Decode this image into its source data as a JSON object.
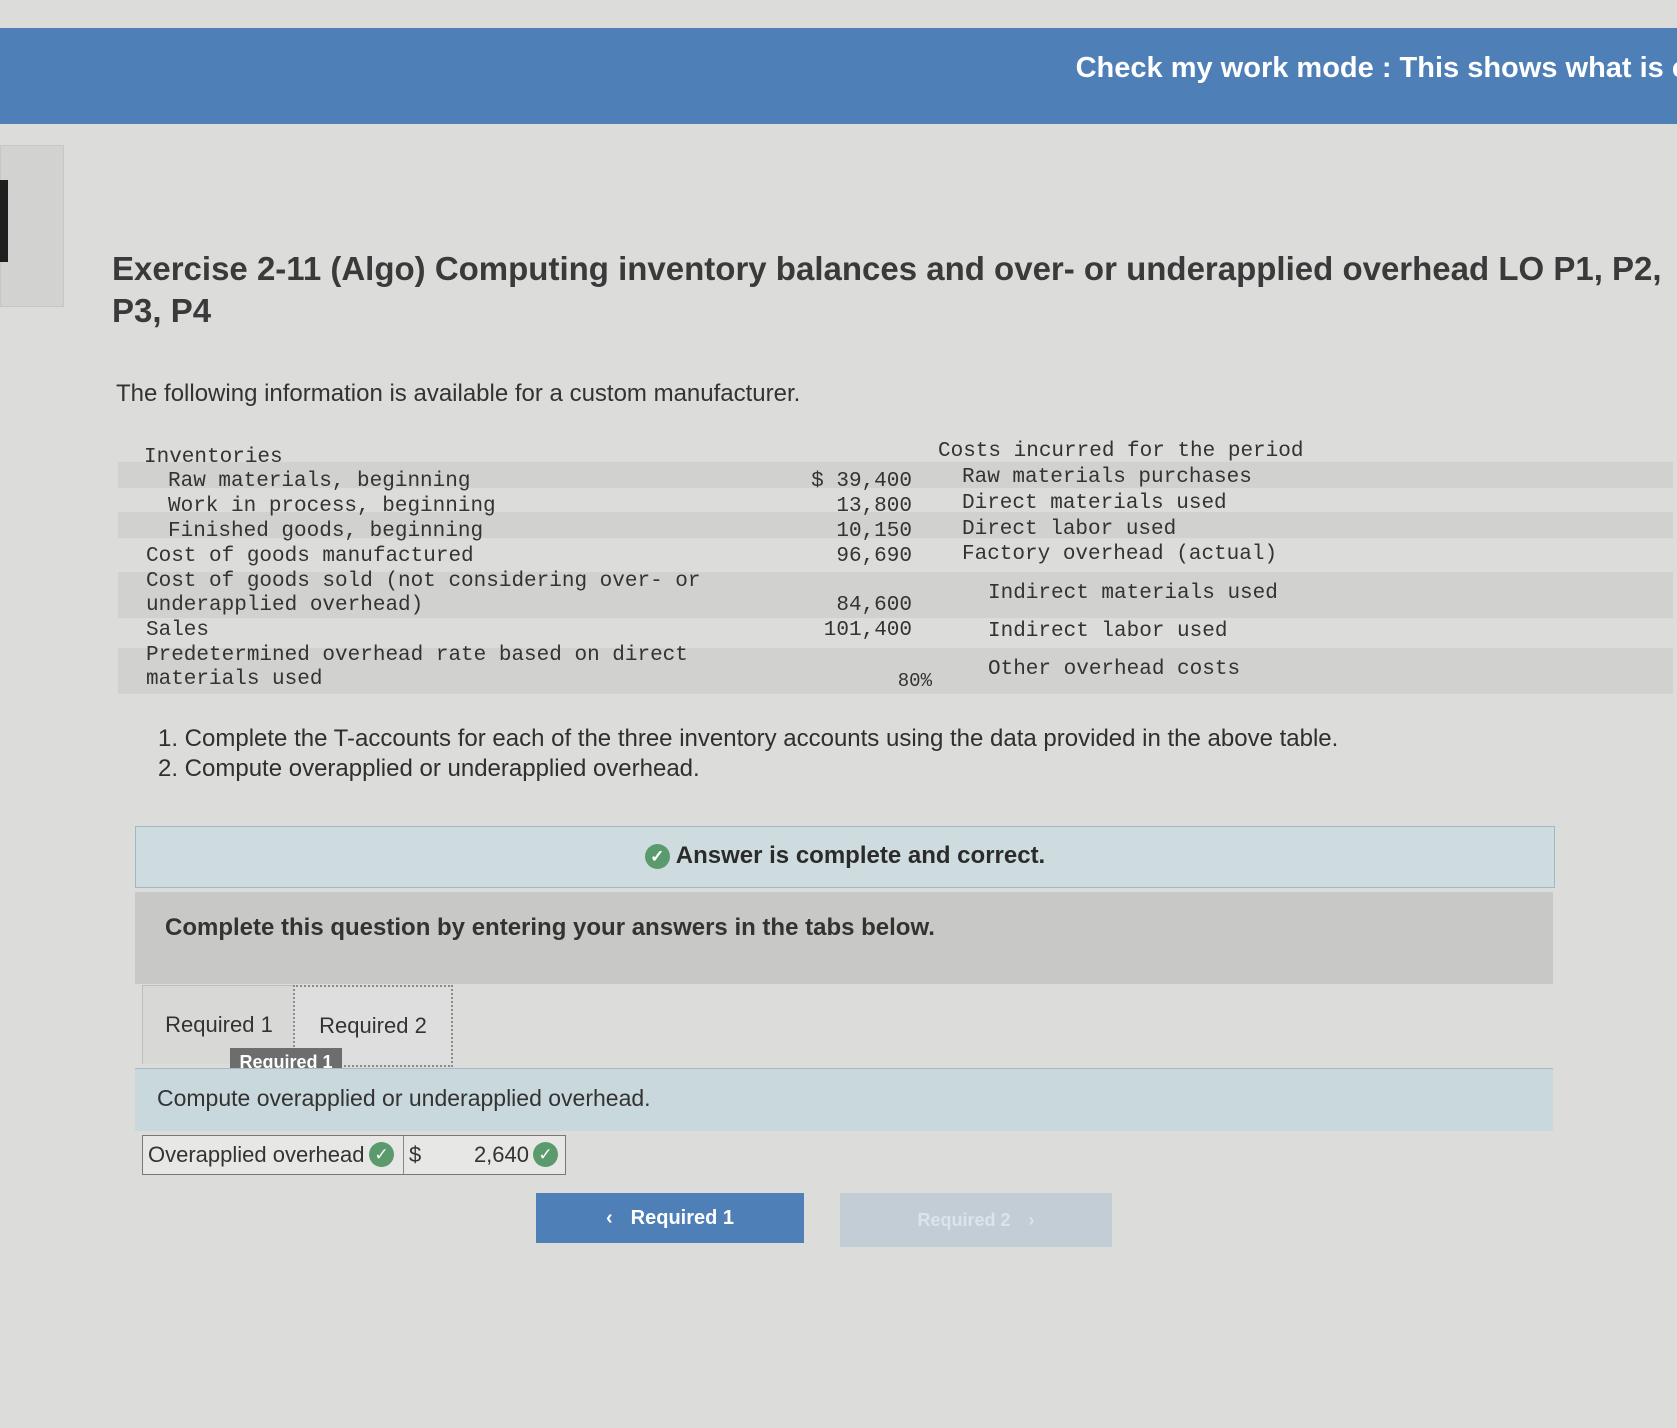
{
  "header": {
    "mode_text": "Check my work mode : This shows what is cor"
  },
  "exercise": {
    "title": "Exercise 2-11 (Algo) Computing inventory balances and over- or underapplied overhead LO P1, P2, P3, P4",
    "intro": "The following information is available for a custom manufacturer."
  },
  "data_table": {
    "left": {
      "inventories_heading": "Inventories",
      "rows": [
        {
          "label": "Raw materials, beginning",
          "value": "$ 39,400"
        },
        {
          "label": "Work in process, beginning",
          "value": "13,800"
        },
        {
          "label": "Finished goods, beginning",
          "value": "10,150"
        },
        {
          "label": "Cost of goods manufactured",
          "value": "96,690"
        },
        {
          "label": "Cost of goods sold (not considering over- or",
          "label2": "underapplied overhead)",
          "value": "84,600"
        },
        {
          "label": "Sales",
          "value": "101,400"
        },
        {
          "label": "Predetermined overhead rate based on direct",
          "label2": "materials used",
          "value": "80%"
        }
      ]
    },
    "right": {
      "heading": "Costs incurred for the period",
      "rows": [
        "Raw materials purchases",
        "Direct materials used",
        "Direct labor used",
        "Factory overhead (actual)",
        "Indirect materials used",
        "Indirect labor used",
        "Other overhead costs"
      ]
    }
  },
  "instructions": [
    "1. Complete the T-accounts for each of the three inventory accounts using the data provided in the above table.",
    "2. Compute overapplied or underapplied overhead."
  ],
  "banner": {
    "text": "Answer is complete and correct."
  },
  "instruction_box": {
    "text": "Complete this question by entering your answers in the tabs below."
  },
  "tabs": [
    {
      "label": "Required 1"
    },
    {
      "label": "Required 2"
    }
  ],
  "tooltip": "Required 1",
  "panel": {
    "text": "Compute overapplied or underapplied overhead."
  },
  "answer": {
    "label": "Overapplied overhead",
    "currency": "$",
    "value": "2,640"
  },
  "nav": {
    "prev_label": "Required 1",
    "next_label": "Required 2"
  },
  "colors": {
    "accent": "#4e7fb6",
    "correct": "#5b9a6c"
  }
}
